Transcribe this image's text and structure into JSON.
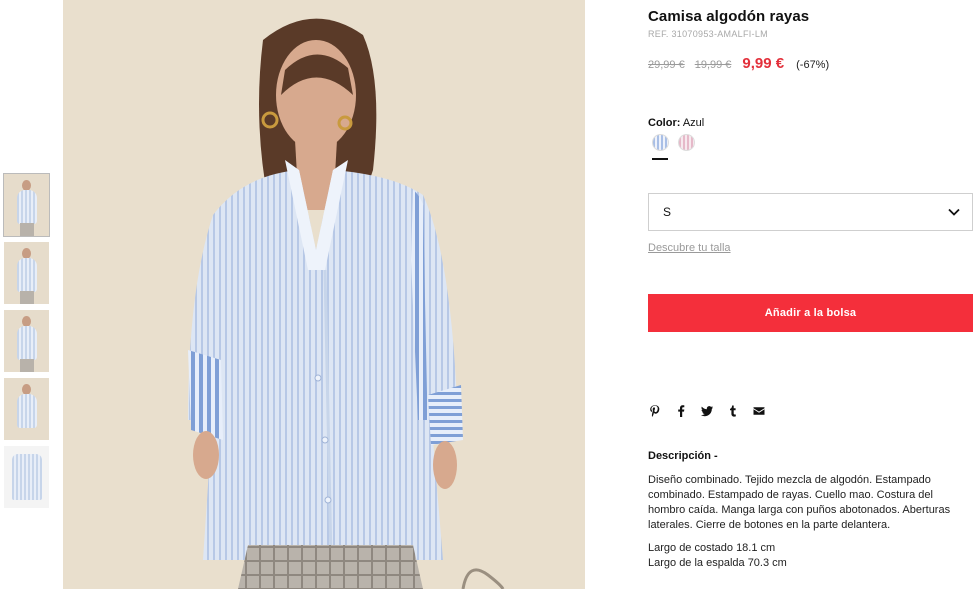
{
  "product": {
    "title": "Camisa algodón rayas",
    "ref": "REF. 31070953-AMALFI-LM",
    "price_original_1": "29,99 €",
    "price_original_2": "19,99 €",
    "price_current": "9,99 €",
    "discount": "(-67%)"
  },
  "color": {
    "label": "Color:",
    "value": "Azul",
    "options": [
      "blue-stripe",
      "pink-stripe"
    ],
    "selected": "blue-stripe"
  },
  "size": {
    "selected": "S",
    "guide_link": "Descubre tu talla"
  },
  "cart": {
    "add_label": "Añadir a la bolsa"
  },
  "share": {
    "icons": [
      "pinterest-icon",
      "facebook-icon",
      "twitter-icon",
      "tumblr-icon",
      "mail-icon"
    ]
  },
  "description": {
    "title": "Descripción -",
    "body": "Diseño combinado. Tejido mezcla de algodón. Estampado combinado. Estampado de rayas. Cuello mao. Costura del hombro caída. Manga larga con puños abotonados. Aberturas laterales. Cierre de botones en la parte delantera.",
    "measure_1": "Largo de costado 18.1 cm",
    "measure_2": "Largo de la espalda 70.3 cm"
  },
  "colors": {
    "accent_red": "#f42f3b",
    "price_red": "#e3303b",
    "photo_bg": "#e9dfcd"
  },
  "gallery": {
    "thumbnails_count": 5,
    "active_index": 0
  }
}
